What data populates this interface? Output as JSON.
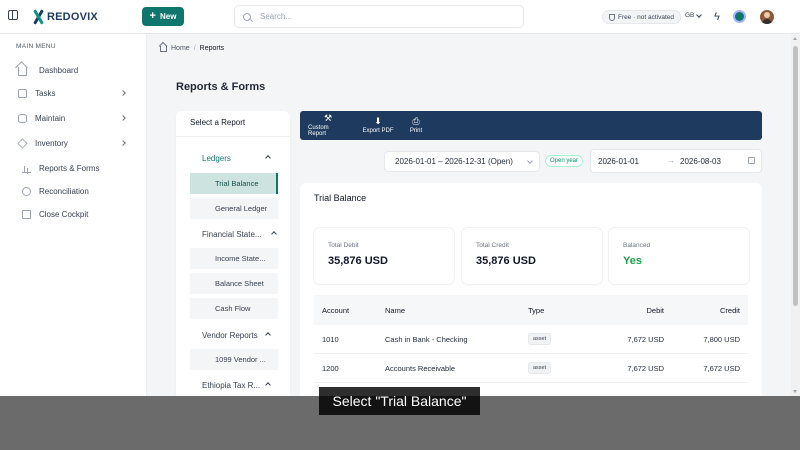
{
  "app": {
    "brand": "REDOVIX"
  },
  "header": {
    "new_label": "New",
    "search_placeholder": "Search...",
    "plan_status": "Free · not activated",
    "language": "GB"
  },
  "sidebar": {
    "heading": "MAIN MENU",
    "items": [
      {
        "label": "Dashboard",
        "icon": "home-icon"
      },
      {
        "label": "Tasks",
        "icon": "check-square-icon"
      },
      {
        "label": "Maintain",
        "icon": "database-icon"
      },
      {
        "label": "Inventory",
        "icon": "box-icon"
      },
      {
        "label": "Reports & Forms",
        "icon": "bar-chart-icon"
      },
      {
        "label": "Reconciliation",
        "icon": "circle-check-icon"
      },
      {
        "label": "Close Cockpit",
        "icon": "clipboard-icon"
      }
    ]
  },
  "breadcrumb": {
    "home": "Home",
    "separator": "/",
    "current": "Reports"
  },
  "page": {
    "title": "Reports & Forms"
  },
  "report_selector": {
    "title": "Select a Report",
    "groups": [
      {
        "label": "Ledgers",
        "items": [
          "Trial Balance",
          "General Ledger"
        ]
      },
      {
        "label": "Financial State...",
        "items": [
          "Income State...",
          "Balance Sheet",
          "Cash Flow"
        ]
      },
      {
        "label": "Vendor Reports",
        "items": [
          "1099 Vendor ..."
        ]
      },
      {
        "label": "Ethiopia Tax R...",
        "items": []
      }
    ],
    "selected": "Trial Balance"
  },
  "toolbar": {
    "custom_report": "Custom Report",
    "export_pdf": "Export PDF",
    "print": "Print"
  },
  "filters": {
    "range": "2026-01-01 – 2026-12-31 (Open)",
    "range_status": "Open year",
    "from": "2026-01-01",
    "arrow": "→",
    "to": "2026-08-03"
  },
  "trial_balance": {
    "title": "Trial Balance",
    "stats": [
      {
        "label": "Total Debit",
        "value": "35,876 USD"
      },
      {
        "label": "Total Credit",
        "value": "35,876 USD"
      },
      {
        "label": "Balanced",
        "value": "Yes",
        "color": "#16a34a"
      }
    ],
    "columns": [
      "Account",
      "Name",
      "Type",
      "Debit",
      "Credit"
    ],
    "rows": [
      {
        "account": "1010",
        "name": "Cash in Bank - Checking",
        "type": "asset",
        "debit": "7,672 USD",
        "credit": "7,800 USD"
      },
      {
        "account": "1200",
        "name": "Accounts Receivable",
        "type": "asset",
        "debit": "7,672 USD",
        "credit": "7,672 USD"
      }
    ]
  },
  "caption": "Select \"Trial Balance\"",
  "colors": {
    "primary": "#0f766e",
    "navy": "#1e3a5f",
    "success": "#16a34a"
  }
}
